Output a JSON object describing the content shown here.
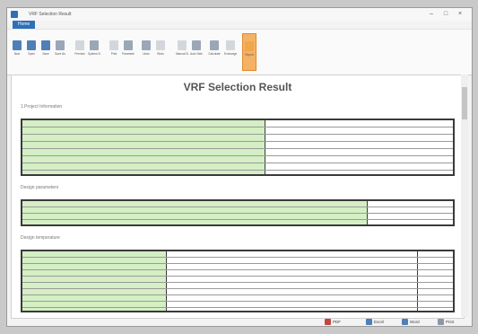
{
  "window": {
    "title": "VRF Selection Result"
  },
  "tab": {
    "label": "Home"
  },
  "toolbar": [
    {
      "label": "New"
    },
    {
      "label": "Open"
    },
    {
      "label": "Save"
    },
    {
      "label": "Save As"
    },
    {
      "label": "Preview"
    },
    {
      "label": "System Settings"
    },
    {
      "label": "Print"
    },
    {
      "label": "Parameters"
    },
    {
      "label": "Undo"
    },
    {
      "label": "Redo"
    },
    {
      "label": "Manual Selection"
    },
    {
      "label": "Auto Selection"
    },
    {
      "label": "Calculate"
    },
    {
      "label": "Exchange Ratio"
    },
    {
      "label": "Report"
    }
  ],
  "document": {
    "title": "VRF Selection Result",
    "section1": "1.Project Information",
    "section2": "Design parameters",
    "section3": "Design temperature"
  },
  "bottom_actions": {
    "pdf": "PDF",
    "excel": "Excel",
    "word": "Word",
    "print": "Print"
  },
  "colors": {
    "accent": "#2f6fb7",
    "green_cell": "#d4efc4",
    "active_button": "#f4b266"
  }
}
